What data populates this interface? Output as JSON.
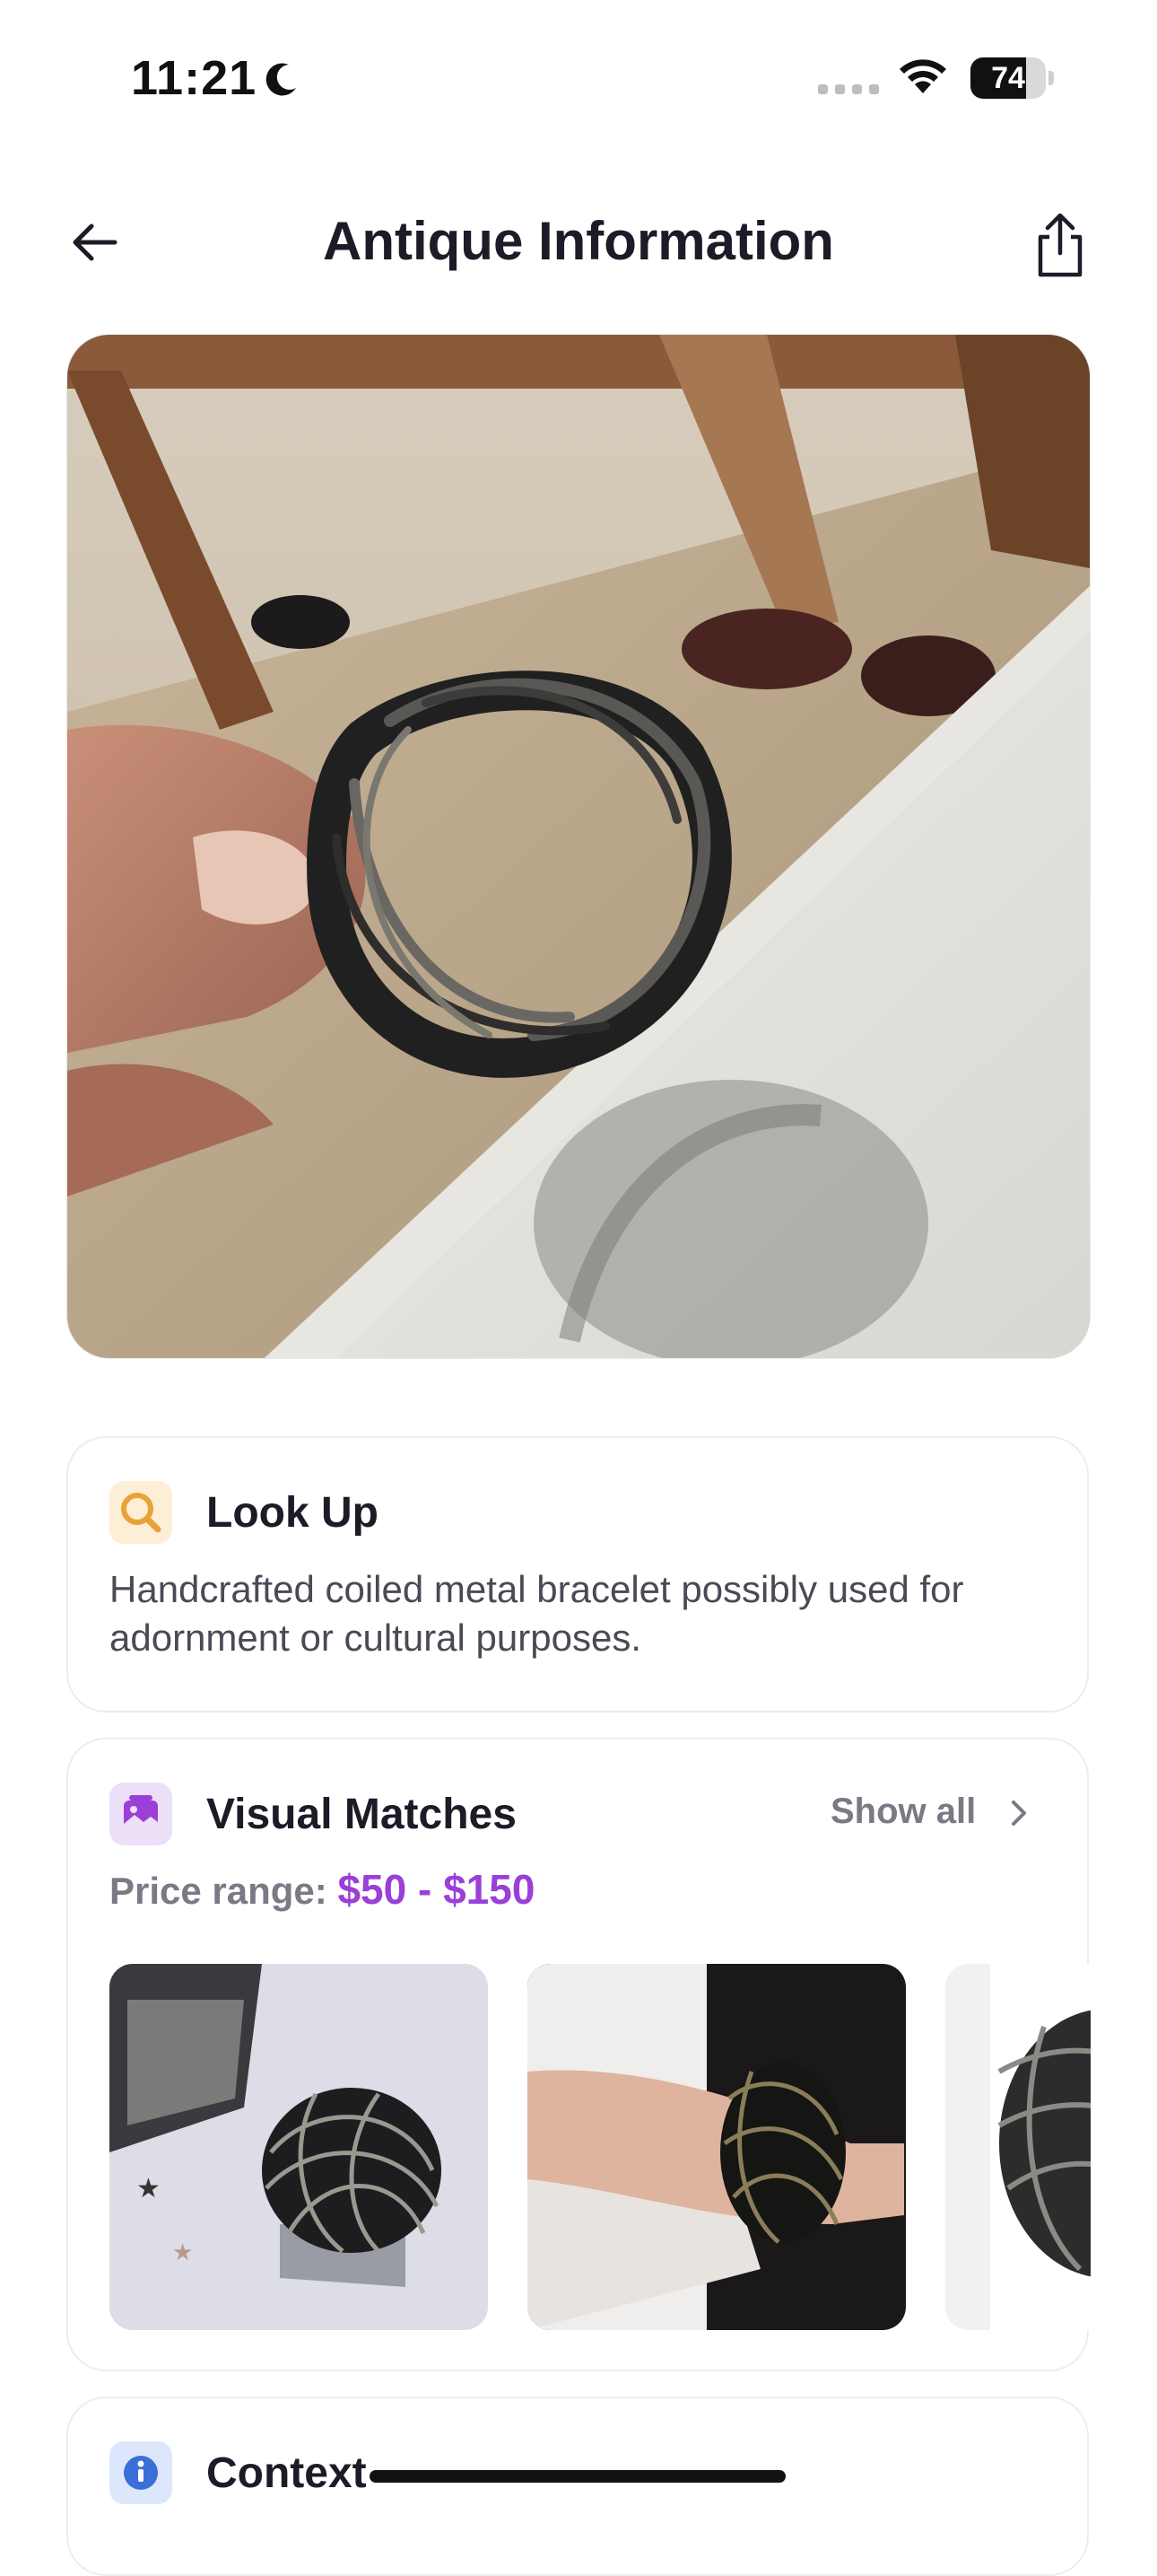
{
  "status_bar": {
    "time": "11:21",
    "battery": "74",
    "battery_level": 0.74
  },
  "nav": {
    "title": "Antique Information"
  },
  "hero": {
    "alt": "Coiled metal bracelet held in hand"
  },
  "look_up": {
    "title": "Look Up",
    "description": "Handcrafted coiled metal bracelet possibly used for adornment or cultural purposes."
  },
  "visual_matches": {
    "title": "Visual Matches",
    "show_all": "Show all",
    "price_label": "Price range:",
    "price_value": "$50 - $150"
  },
  "context": {
    "title": "Context"
  },
  "colors": {
    "accent_purple": "#9a3fd8",
    "lookup_orange": "#e8a23a",
    "context_blue": "#3a6fd8"
  },
  "icons": {
    "back": "arrow-left-icon",
    "share": "share-icon",
    "lookup": "search-icon",
    "matches": "image-icon",
    "context": "info-icon",
    "chevron": "chevron-right-icon",
    "moon": "moon-icon",
    "wifi": "wifi-icon"
  }
}
